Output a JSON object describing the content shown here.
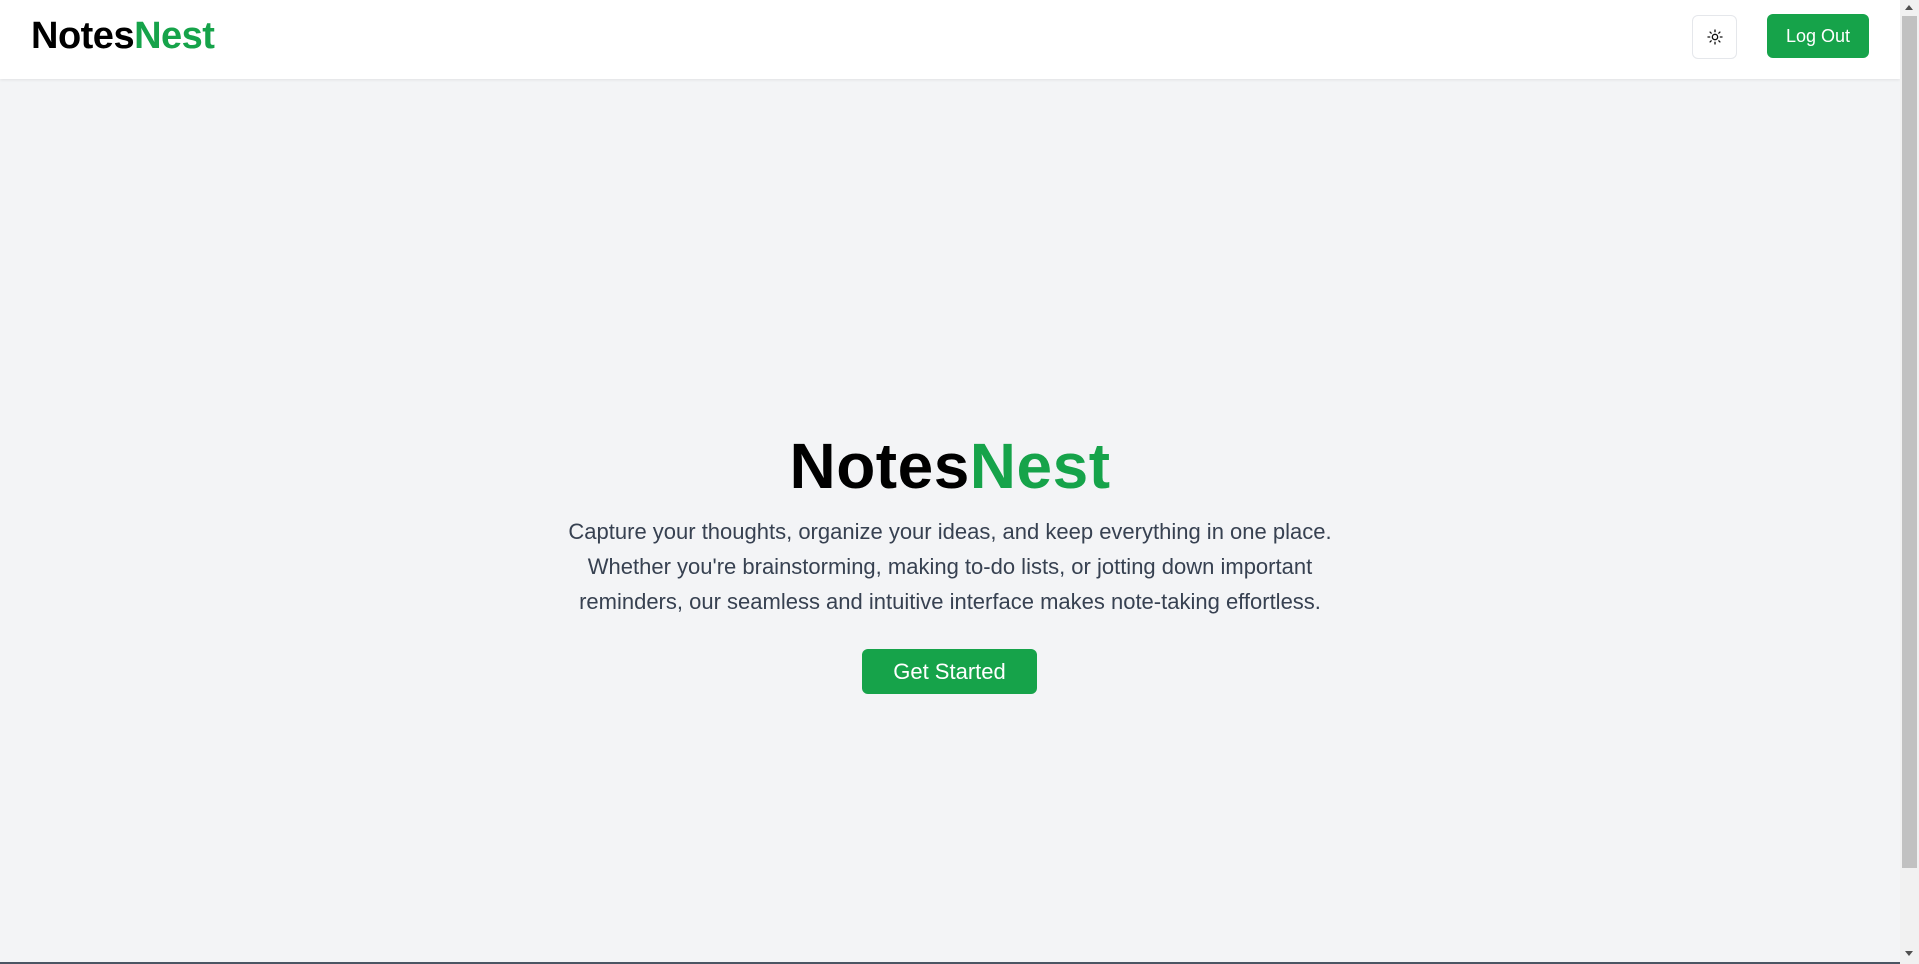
{
  "navbar": {
    "logo_part1": "Notes",
    "logo_part2": "Nest",
    "theme_toggle_icon": "sun-icon",
    "logout_label": "Log Out"
  },
  "hero": {
    "title_part1": "Notes",
    "title_part2": "Nest",
    "description": "Capture your thoughts, organize your ideas, and keep everything in one place. Whether you're brainstorming, making to-do lists, or jotting down important reminders, our seamless and intuitive interface makes note-taking effortless.",
    "cta_label": "Get Started"
  },
  "colors": {
    "accent": "#16a34a",
    "background": "#f3f4f6",
    "navbar": "#ffffff",
    "text_primary": "#000000",
    "text_secondary": "#374151"
  }
}
